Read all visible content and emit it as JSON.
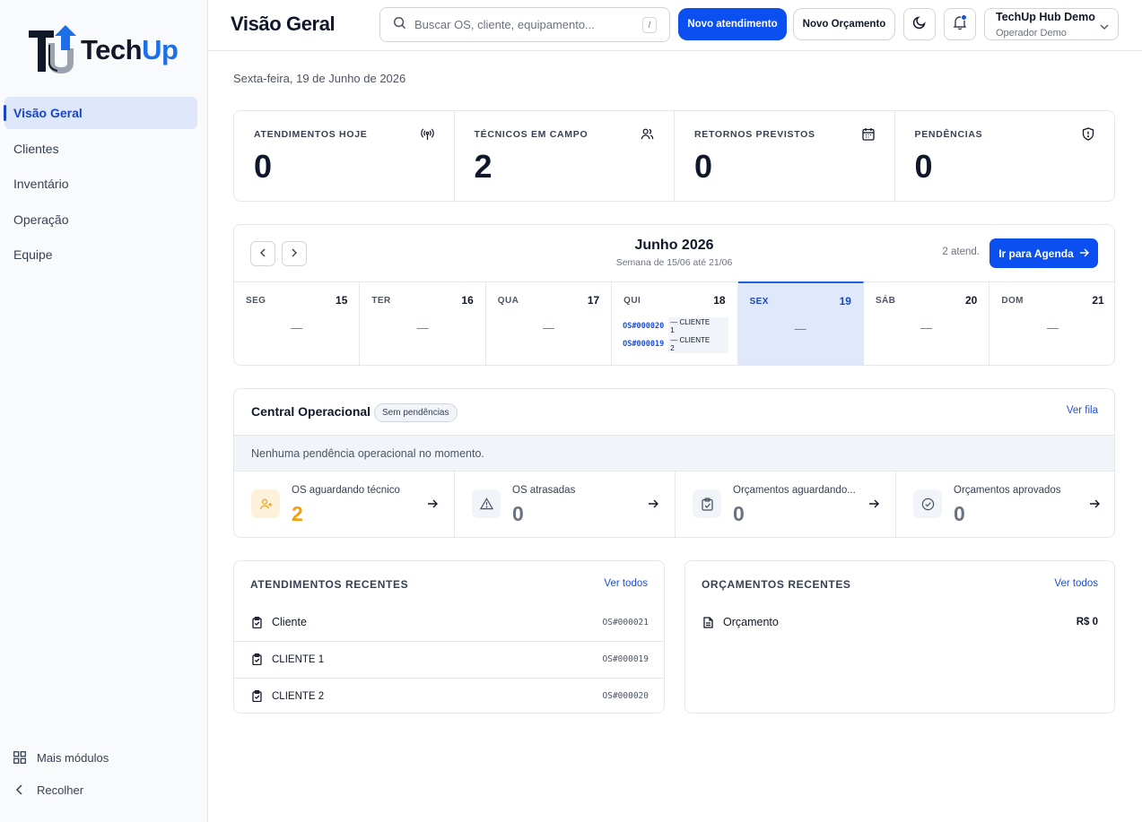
{
  "brand": {
    "logo_text_main": "Tech",
    "logo_text_accent": "Up",
    "accent": "#0b4ff0"
  },
  "sidebar": {
    "items": [
      {
        "label": "Visão Geral",
        "active": true
      },
      {
        "label": "Clientes"
      },
      {
        "label": "Inventário"
      },
      {
        "label": "Operação"
      },
      {
        "label": "Equipe"
      }
    ],
    "more_modules": "Mais módulos",
    "collapse": "Recolher"
  },
  "header": {
    "title": "Visão Geral",
    "search_placeholder": "Buscar OS, cliente, equipamento...",
    "search_shortcut": "/",
    "new_service_button": "Novo atendimento",
    "new_quote_button": "Novo Orçamento",
    "user_name": "TechUp Hub Demo",
    "user_role": "Operador Demo"
  },
  "date_line": "Sexta-feira, 19 de Junho de 2026",
  "stats": [
    {
      "label": "ATENDIMENTOS HOJE",
      "value": "0",
      "icon": "broadcast-icon"
    },
    {
      "label": "TÉCNICOS EM CAMPO",
      "value": "2",
      "icon": "users-icon"
    },
    {
      "label": "RETORNOS PREVISTOS",
      "value": "0",
      "icon": "calendar-icon"
    },
    {
      "label": "PENDÊNCIAS",
      "value": "0",
      "icon": "shield-alert-icon"
    }
  ],
  "calendar": {
    "title": "Junho 2026",
    "subtitle": "Semana de 15/06 até 21/06",
    "count": "2 atend.",
    "agenda_button": "Ir para Agenda",
    "empty_marker": "—",
    "days": [
      {
        "name": "SEG",
        "num": "15",
        "events": []
      },
      {
        "name": "TER",
        "num": "16",
        "events": []
      },
      {
        "name": "QUA",
        "num": "17",
        "events": []
      },
      {
        "name": "QUI",
        "num": "18",
        "events": [
          {
            "os": "OS#000020",
            "client": "— CLIENTE 1"
          },
          {
            "os": "OS#000019",
            "client": "— CLIENTE 2"
          }
        ]
      },
      {
        "name": "SEX",
        "num": "19",
        "events": [],
        "today": true
      },
      {
        "name": "SÁB",
        "num": "20",
        "events": []
      },
      {
        "name": "DOM",
        "num": "21",
        "events": []
      }
    ]
  },
  "central": {
    "title": "Central Operacional",
    "badge": "Sem pendências",
    "link": "Ver fila",
    "info": "Nenhuma pendência operacional no momento.",
    "metrics": [
      {
        "label": "OS aguardando técnico",
        "value": "2",
        "icon": "user-plus-icon",
        "warn": true
      },
      {
        "label": "OS atrasadas",
        "value": "0",
        "icon": "alert-triangle-icon"
      },
      {
        "label": "Orçamentos aguardando...",
        "value": "0",
        "icon": "clipboard-check-icon"
      },
      {
        "label": "Orçamentos aprovados",
        "value": "0",
        "icon": "check-circle-icon"
      }
    ]
  },
  "recent_services": {
    "title": "ATENDIMENTOS RECENTES",
    "link": "Ver todos",
    "rows": [
      {
        "name": "Cliente",
        "code": "OS#000021"
      },
      {
        "name": "CLIENTE 1",
        "code": "OS#000019"
      },
      {
        "name": "CLIENTE 2",
        "code": "OS#000020"
      }
    ]
  },
  "recent_quotes": {
    "title": "ORÇAMENTOS RECENTES",
    "link": "Ver todos",
    "rows": [
      {
        "name": "Orçamento",
        "value": "R$ 0"
      }
    ]
  }
}
